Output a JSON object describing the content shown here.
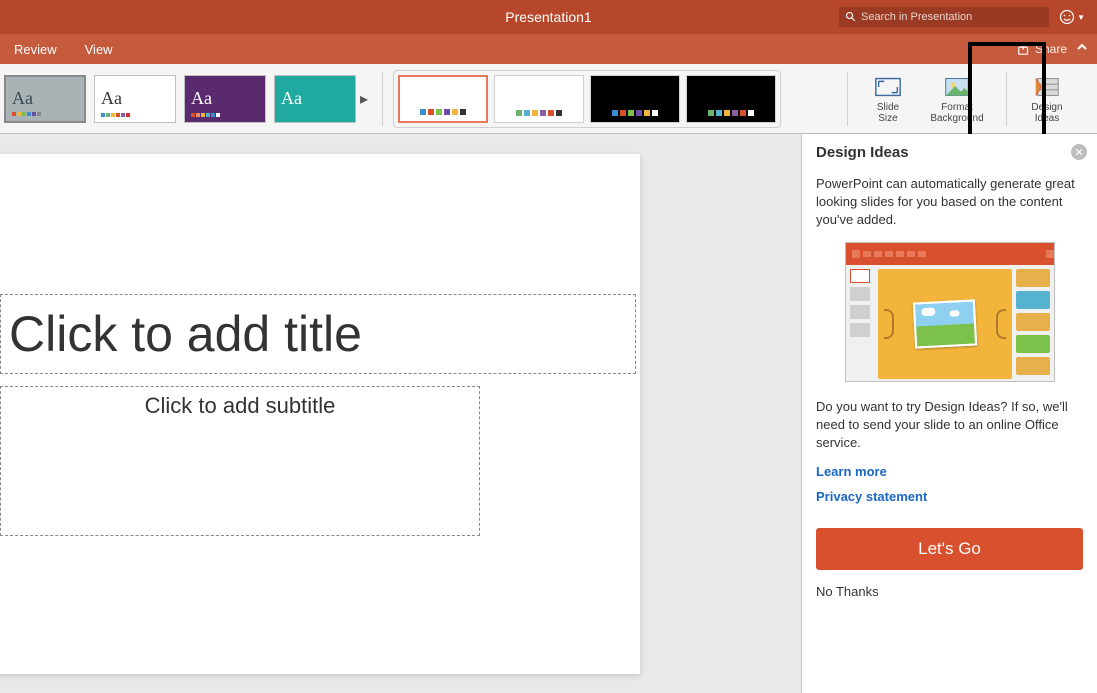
{
  "title": "Presentation1",
  "search": {
    "placeholder": "Search in Presentation"
  },
  "tabs": [
    "Review",
    "View"
  ],
  "share_label": "Share",
  "themes": [
    {
      "bg": "#a9b3b5",
      "fg": "#37474f",
      "colors": [
        "#d9502e",
        "#f2b43a",
        "#7cc24a",
        "#3a8dd0",
        "#6a4fa0",
        "#888888"
      ]
    },
    {
      "bg": "#ffffff",
      "fg": "#333333",
      "colors": [
        "#3a8dd0",
        "#6cb36c",
        "#f2b43a",
        "#d9502e",
        "#8a5fa0",
        "#c33"
      ]
    },
    {
      "bg": "#5a2a6e",
      "fg": "#ffffff",
      "colors": [
        "#d9502e",
        "#ef8a62",
        "#f2b43a",
        "#55b3d0",
        "#3a8dd0",
        "#fff"
      ]
    },
    {
      "bg": "#1fa9a0",
      "fg": "#ffffff",
      "colors": [
        "#1fa9a0",
        "#1fa9a0",
        "#1fa9a0",
        "#1fa9a0",
        "#1fa9a0",
        "#1fa9a0"
      ]
    }
  ],
  "variants": [
    {
      "bg": "#ffffff",
      "sel": true,
      "colors": [
        "#3a8dd0",
        "#d9502e",
        "#7cc24a",
        "#6a4fa0",
        "#f2b43a",
        "#333"
      ]
    },
    {
      "bg": "#ffffff",
      "sel": false,
      "colors": [
        "#6cb36c",
        "#55b3d0",
        "#f2b43a",
        "#8a5fa0",
        "#d9502e",
        "#333"
      ]
    },
    {
      "bg": "#000000",
      "sel": false,
      "colors": [
        "#3a8dd0",
        "#d9502e",
        "#7cc24a",
        "#6a4fa0",
        "#f2b43a",
        "#fff"
      ]
    },
    {
      "bg": "#000000",
      "sel": false,
      "colors": [
        "#6cb36c",
        "#55b3d0",
        "#f2b43a",
        "#8a5fa0",
        "#d9502e",
        "#fff"
      ]
    }
  ],
  "ribbon_buttons": {
    "slide_size": "Slide\nSize",
    "format_bg": "Format\nBackground",
    "design_ideas": "Design\nIdeas"
  },
  "slide": {
    "title_placeholder": "Click to add title",
    "subtitle_placeholder": "Click to add subtitle"
  },
  "panel": {
    "title": "Design Ideas",
    "intro": "PowerPoint can automatically generate great looking slides for you based on the content you've added.",
    "prompt": "Do you want to try Design Ideas? If so, we'll need to send your slide to an online Office service.",
    "learn_more": "Learn more",
    "privacy": "Privacy statement",
    "go": "Let's Go",
    "nothanks": "No Thanks"
  }
}
